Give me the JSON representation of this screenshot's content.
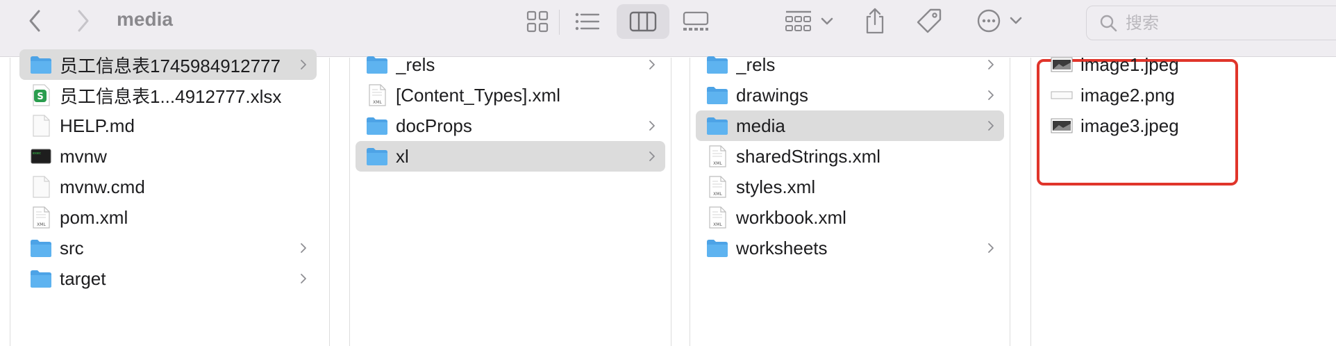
{
  "toolbar": {
    "title": "media",
    "search_placeholder": "搜索"
  },
  "columns": [
    {
      "items": [
        {
          "label": "员工信息表1745984912777",
          "type": "folder",
          "selected": true,
          "chevron": true
        },
        {
          "label": "员工信息表1...4912777.xlsx",
          "type": "xlsx"
        },
        {
          "label": "HELP.md",
          "type": "doc"
        },
        {
          "label": "mvnw",
          "type": "exec"
        },
        {
          "label": "mvnw.cmd",
          "type": "doc"
        },
        {
          "label": "pom.xml",
          "type": "xml"
        },
        {
          "label": "src",
          "type": "folder",
          "chevron": true
        },
        {
          "label": "target",
          "type": "folder",
          "chevron": true
        }
      ]
    },
    {
      "items": [
        {
          "label": "_rels",
          "type": "folder",
          "chevron": true
        },
        {
          "label": "[Content_Types].xml",
          "type": "xml"
        },
        {
          "label": "docProps",
          "type": "folder",
          "chevron": true
        },
        {
          "label": "xl",
          "type": "folder",
          "selected": true,
          "chevron": true
        }
      ]
    },
    {
      "items": [
        {
          "label": "_rels",
          "type": "folder",
          "chevron": true
        },
        {
          "label": "drawings",
          "type": "folder",
          "chevron": true
        },
        {
          "label": "media",
          "type": "folder",
          "selected": true,
          "chevron": true
        },
        {
          "label": "sharedStrings.xml",
          "type": "xml"
        },
        {
          "label": "styles.xml",
          "type": "xml"
        },
        {
          "label": "workbook.xml",
          "type": "xml"
        },
        {
          "label": "worksheets",
          "type": "folder",
          "chevron": true
        }
      ]
    },
    {
      "items": [
        {
          "label": "image1.jpeg",
          "type": "image"
        },
        {
          "label": "image2.png",
          "type": "image-blank"
        },
        {
          "label": "image3.jpeg",
          "type": "image"
        }
      ]
    }
  ],
  "colors": {
    "folder": "#5eb3f0",
    "selection": "#dcdcdc",
    "highlight_box": "#e0352b",
    "toolbar_bg": "#efedf1"
  }
}
